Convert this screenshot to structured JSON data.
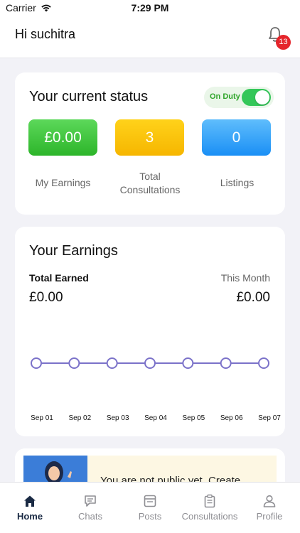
{
  "status_bar": {
    "carrier": "Carrier",
    "time": "7:29 PM"
  },
  "header": {
    "greeting": "Hi suchitra",
    "notification_count": "13"
  },
  "status_card": {
    "title": "Your current status",
    "duty_label": "On Duty",
    "duty_on": true,
    "stats": [
      {
        "value": "£0.00",
        "caption": "My Earnings"
      },
      {
        "value": "3",
        "caption": "Total\nConsultations"
      },
      {
        "value": "0",
        "caption": "Listings"
      }
    ]
  },
  "earnings_card": {
    "title": "Your Earnings",
    "total_label": "Total Earned",
    "total_value": "£0.00",
    "month_label": "This Month",
    "month_value": "£0.00"
  },
  "chart_data": {
    "type": "line",
    "categories": [
      "Sep 01",
      "Sep 02",
      "Sep 03",
      "Sep 04",
      "Sep 05",
      "Sep 06",
      "Sep 07"
    ],
    "values": [
      0,
      0,
      0,
      0,
      0,
      0,
      0
    ],
    "color": "#7b72c9"
  },
  "promo": {
    "text": "You are not public yet. Create"
  },
  "tabs": [
    {
      "label": "Home",
      "active": true
    },
    {
      "label": "Chats",
      "active": false
    },
    {
      "label": "Posts",
      "active": false
    },
    {
      "label": "Consultations",
      "active": false
    },
    {
      "label": "Profile",
      "active": false
    }
  ],
  "colors": {
    "accent_green": "#34c759",
    "badge_red": "#e5252b",
    "tab_active": "#1a2a44"
  }
}
